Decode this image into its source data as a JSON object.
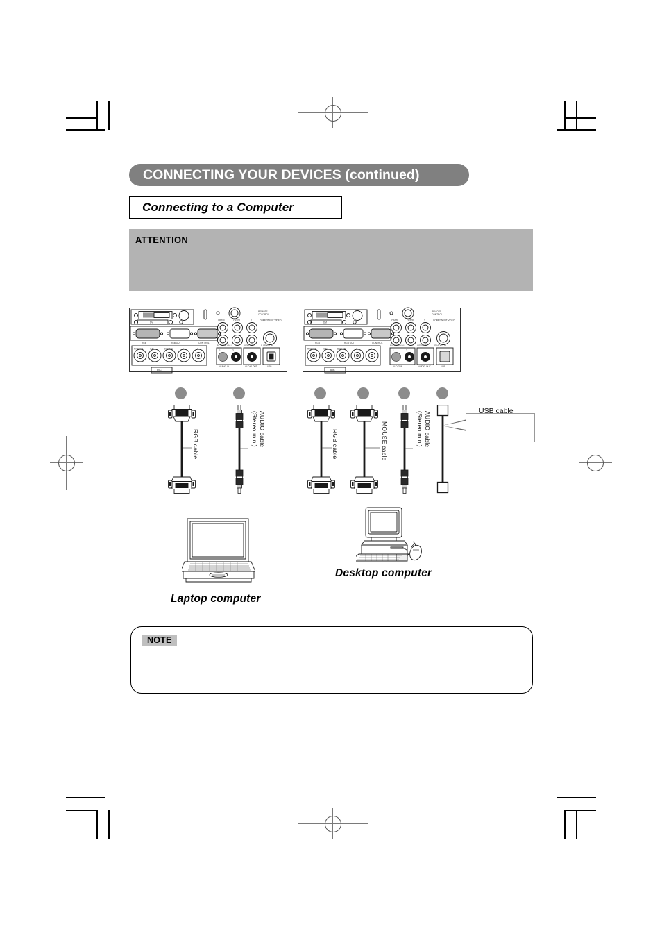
{
  "page": {
    "header_title": "CONNECTING YOUR DEVICES (continued)",
    "section_title": "Connecting to a Computer"
  },
  "attention": {
    "label": "ATTENTION",
    "body": ""
  },
  "note": {
    "label": "NOTE",
    "body": ""
  },
  "colors": {
    "header_bar": "#808080",
    "attention_bg": "#b3b3b3",
    "note_label_bg": "#bfbfbf",
    "connector_dot": "#8c8c8c",
    "page_bg": "#ffffff",
    "line": "#000000"
  },
  "terminal_panel": {
    "labels": {
      "dvi": "DVI",
      "rgb": "RGB",
      "rgb_out": "RGB OUT",
      "control": "CONTROL",
      "bnc": "BNC",
      "bnc_r": "R/CR/PR",
      "bnc_g": "G/Y",
      "bnc_b": "B/CB/PB",
      "bnc_h": "H",
      "bnc_v": "V",
      "component_video": "COMPONENT VIDEO",
      "comp_cb": "CB/PB",
      "comp_cr": "CR/PR",
      "comp_y": "Y",
      "rl_audio_in_l": "R/L AUDIO IN L",
      "video_in": "VIDEO IN",
      "s_video_in": "S-VIDEO IN",
      "audio_in": "AUDIO IN",
      "audio_out": "AUDIO OUT",
      "usb": "USB",
      "audio_in_1": "1",
      "audio_in_2": "2",
      "remote_control": "REMOTE CONTROL"
    }
  },
  "cables": {
    "laptop_group": [
      {
        "name": "RGB cable",
        "label": "RGB cable",
        "connector": "dsub"
      },
      {
        "name": "AUDIO cable",
        "label": "AUDIO cable\n(Stereo mini)",
        "label_line1": "AUDIO cable",
        "label_line2": "(Stereo mini)",
        "connector": "mini"
      }
    ],
    "desktop_group": [
      {
        "name": "RGB cable",
        "label": "RGB cable",
        "connector": "dsub"
      },
      {
        "name": "MOUSE cable",
        "label": "MOUSE cable",
        "connector": "dsub"
      },
      {
        "name": "AUDIO cable",
        "label_line1": "AUDIO cable",
        "label_line2": "(Stereo mini)",
        "connector": "mini"
      },
      {
        "name": "USB cable",
        "label": "USB cable",
        "connector": "usb"
      }
    ],
    "usb_callout_label": "USB cable"
  },
  "computers": [
    {
      "id": "laptop",
      "caption": "Laptop computer"
    },
    {
      "id": "desktop",
      "caption": "Desktop computer"
    }
  ]
}
